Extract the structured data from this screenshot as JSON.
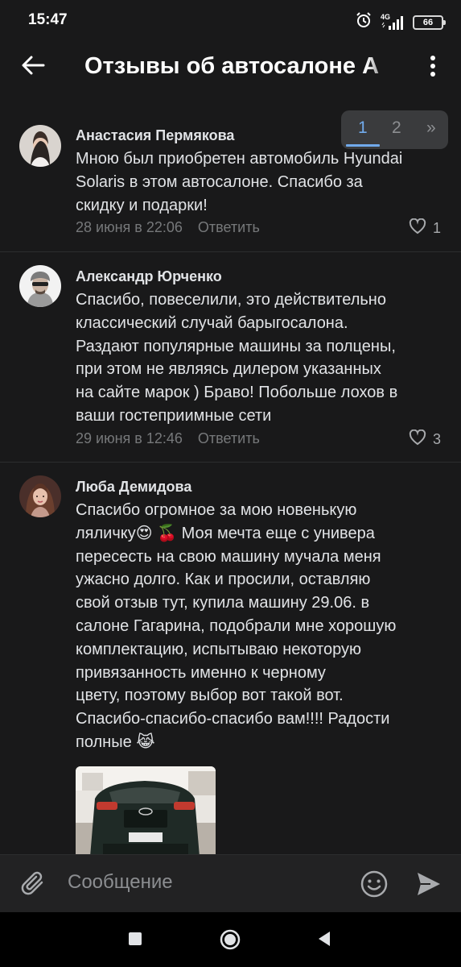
{
  "status_bar": {
    "time": "15:47",
    "network": "4G",
    "battery": "66"
  },
  "header": {
    "title": "Отзывы об автосалоне А",
    "back_icon": "arrow-left-icon",
    "more_icon": "more-vertical-icon"
  },
  "pager": {
    "pages": [
      "1",
      "2"
    ],
    "next": "»",
    "active_page": "1"
  },
  "comments": [
    {
      "author": "Анастасия Пермякова",
      "text_lines": [
        "Мною был приобретен автомобиль Hyundai",
        "Solaris в этом автосалоне. Спасибо за",
        "скидку и подарки!"
      ],
      "date": "28 июня в 22:06",
      "reply_label": "Ответить",
      "likes": "1"
    },
    {
      "author": "Александр Юрченко",
      "text_lines": [
        "Спасибо, повеселили, это действительно",
        "классический случай барыгосалона.",
        "Раздают популярные машины за полцены,",
        "при этом не являясь дилером  указанных",
        "на сайте марок ) Браво! Побольше лохов в",
        "ваши гостеприимные сети"
      ],
      "date": "29 июня в 12:46",
      "reply_label": "Ответить",
      "likes": "3"
    },
    {
      "author": "Люба Демидова",
      "text_lines": [
        "Спасибо огромное за мою новенькую",
        "ляличку😍 🍒  Моя мечта еще с универа",
        "пересесть на свою машину мучала меня",
        "ужасно долго. Как и просили, оставляю",
        "свой отзыв тут, купила машину 29.06. в",
        "салоне Гагарина, подобрали мне хорошую",
        "комплектацию, испытываю некоторую",
        "привязанность именно к черному",
        "цвету, поэтому выбор вот такой вот.",
        "Спасибо-спасибо-спасибо вам!!!! Радости",
        "полные 😹"
      ]
    }
  ],
  "composer": {
    "placeholder": "Сообщение"
  },
  "colors": {
    "background": "#19191a",
    "accent": "#71aaeb",
    "text": "#e1e3e6",
    "secondary": "#76787a",
    "composer": "#222223"
  }
}
